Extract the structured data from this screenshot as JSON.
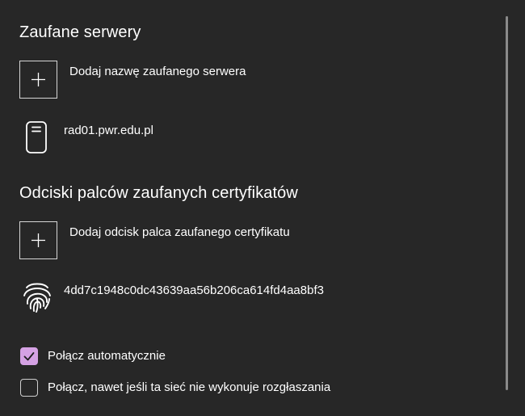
{
  "trusted_servers": {
    "title": "Zaufane serwery",
    "add_label": "Dodaj nazwę zaufanego serwera",
    "items": [
      {
        "name": "rad01.pwr.edu.pl",
        "icon": "server-icon"
      }
    ]
  },
  "trusted_certificates": {
    "title": "Odciski palców zaufanych certyfikatów",
    "add_label": "Dodaj odcisk palca zaufanego certyfikatu",
    "items": [
      {
        "thumbprint": "4dd7c1948c0dc43639aa56b206ca614fd4aa8bf3",
        "icon": "fingerprint-icon"
      }
    ]
  },
  "options": [
    {
      "label": "Połącz automatycznie",
      "checked": true
    },
    {
      "label": "Połącz, nawet jeśli ta sieć nie wykonuje rozgłaszania",
      "checked": false
    }
  ],
  "colors": {
    "background": "#272727",
    "accent": "#d5a2e4",
    "text": "#ffffff"
  }
}
